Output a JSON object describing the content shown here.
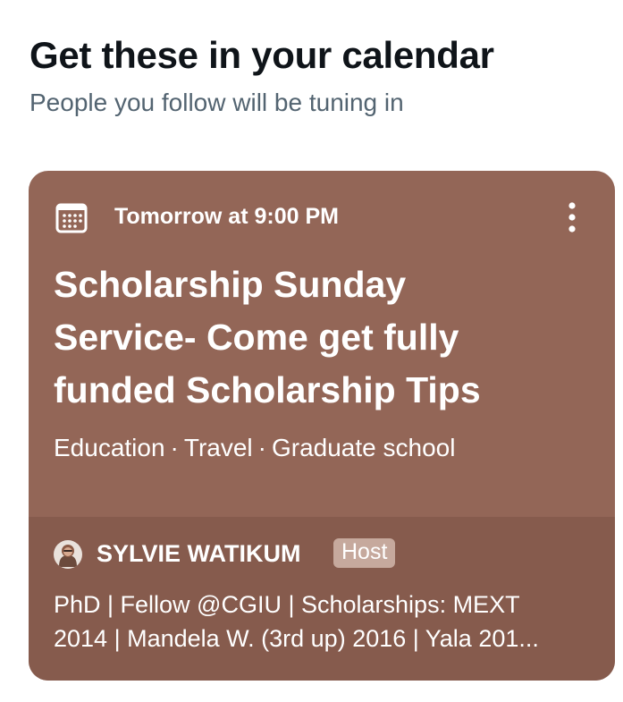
{
  "section": {
    "title": "Get these in your calendar",
    "subtitle": "People you follow will be tuning in"
  },
  "card": {
    "background_color": "#936657",
    "footer_color": "#865b4d",
    "icon": "calendar-icon",
    "more_icon": "more-vertical-icon",
    "schedule": "Tomorrow at 9:00 PM",
    "title_lines": [
      "Scholarship Sunday",
      "Service- Come get fully",
      "funded Scholarship Tips"
    ],
    "topics": [
      "Education",
      "Travel",
      "Graduate school"
    ],
    "topic_separator": "·",
    "host": {
      "avatar_icon": "user-avatar",
      "name": "SYLVIE WATIKUM",
      "badge": "Host",
      "bio_lines": [
        "PhD | Fellow @CGIU | Scholarships: MEXT",
        "2014 | Mandela W. (3rd up) 2016 | Yala 201..."
      ]
    }
  }
}
